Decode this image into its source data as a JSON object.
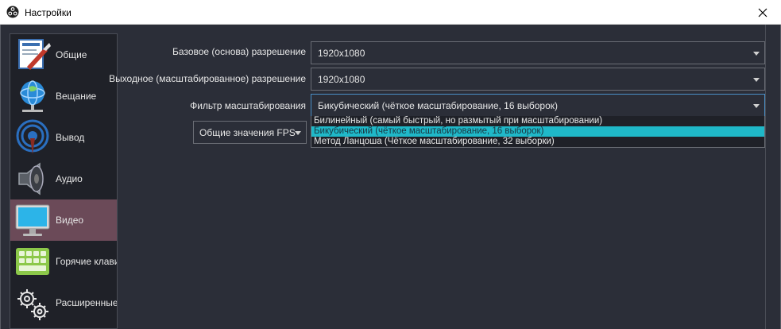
{
  "window": {
    "title": "Настройки"
  },
  "sidebar": {
    "items": [
      {
        "label": "Общие",
        "icon": "general-settings-icon",
        "active": false
      },
      {
        "label": "Вещание",
        "icon": "stream-globe-icon",
        "active": false
      },
      {
        "label": "Вывод",
        "icon": "output-broadcast-icon",
        "active": false
      },
      {
        "label": "Аудио",
        "icon": "speaker-icon",
        "active": false
      },
      {
        "label": "Видео",
        "icon": "monitor-icon",
        "active": true
      },
      {
        "label": "Горячие клави",
        "icon": "keyboard-icon",
        "active": false
      },
      {
        "label": "Расширенные",
        "icon": "gears-icon",
        "active": false
      }
    ]
  },
  "video": {
    "base_resolution_label": "Базовое (основа) разрешение",
    "base_resolution_value": "1920x1080",
    "output_resolution_label": "Выходное (масштабированное) разрешение",
    "output_resolution_value": "1920x1080",
    "scale_filter_label": "Фильтр масштабирования",
    "scale_filter_value": "Бикубический (чёткое масштабирование, 16 выборок)",
    "scale_filter_options": [
      "Билинейный (самый быстрый, но размытый при масштабировании)",
      "Бикубический (чёткое масштабирование, 16 выборок)",
      "Метод Ланцоша (Чёткое масштабирование, 32 выборки)"
    ],
    "scale_filter_selected_index": 1,
    "fps_type_value": "Общие значения FPS"
  },
  "colors": {
    "background": "#2b2e38",
    "active_sidebar": "#6b4a58",
    "selection": "#1fb8c8"
  }
}
